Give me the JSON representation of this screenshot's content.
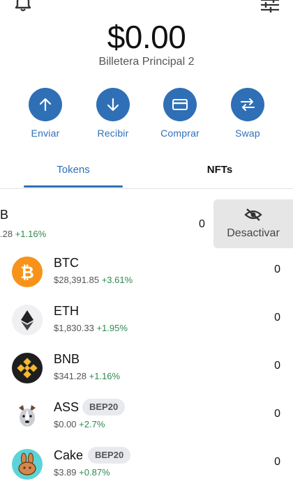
{
  "header": {
    "balance": "$0.00",
    "wallet_name": "Billetera Principal 2"
  },
  "actions": [
    {
      "label": "Enviar",
      "icon": "arrow-up-icon"
    },
    {
      "label": "Recibir",
      "icon": "arrow-down-icon"
    },
    {
      "label": "Comprar",
      "icon": "card-icon"
    },
    {
      "label": "Swap",
      "icon": "swap-icon"
    }
  ],
  "tabs": [
    {
      "label": "Tokens",
      "active": true
    },
    {
      "label": "NFTs",
      "active": false
    }
  ],
  "swiped_row": {
    "symbol": "B",
    "price": ".28",
    "change": "+1.16%",
    "amount": "0",
    "action_label": "Desactivar"
  },
  "tokens": [
    {
      "symbol": "BTC",
      "price": "$28,391.85",
      "change": "+3.61%",
      "amount": "0",
      "badge": ""
    },
    {
      "symbol": "ETH",
      "price": "$1,830.33",
      "change": "+1.95%",
      "amount": "0",
      "badge": ""
    },
    {
      "symbol": "BNB",
      "price": "$341.28",
      "change": "+1.16%",
      "amount": "0",
      "badge": ""
    },
    {
      "symbol": "ASS",
      "price": "$0.00",
      "change": "+2.7%",
      "amount": "0",
      "badge": "BEP20"
    },
    {
      "symbol": "Cake",
      "price": "$3.89",
      "change": "+0.87%",
      "amount": "0",
      "badge": "BEP20"
    }
  ],
  "colors": {
    "accent": "#2f6fb6",
    "positive": "#2e8a4e",
    "btc": "#f7931a",
    "bnb": "#f3ba2f",
    "cake": "#5cd3d8"
  }
}
